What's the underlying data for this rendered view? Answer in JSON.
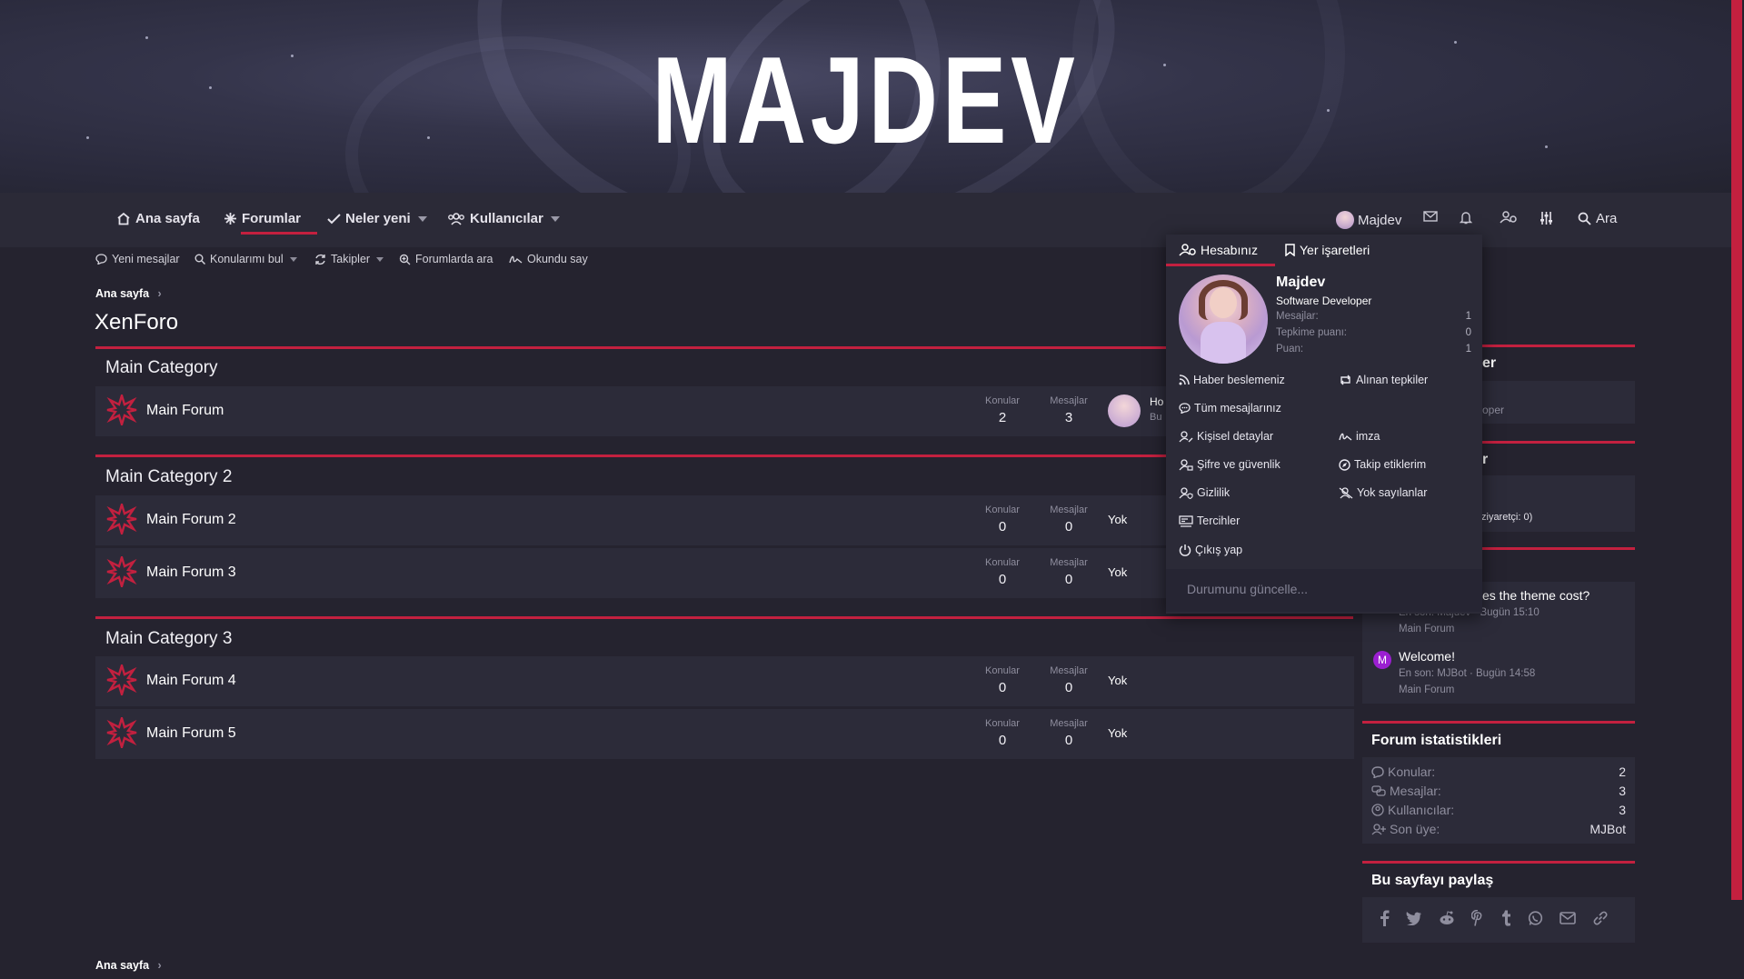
{
  "logo": {
    "text": "MAJDEV"
  },
  "nav": {
    "items": [
      {
        "label": "Ana sayfa"
      },
      {
        "label": "Forumlar"
      },
      {
        "label": "Neler yeni"
      },
      {
        "label": "Kullanıcılar"
      }
    ],
    "user": {
      "label": "Majdev"
    },
    "search": {
      "label": "Ara"
    }
  },
  "subnav": {
    "items": [
      {
        "label": "Yeni mesajlar"
      },
      {
        "label": "Konularımı bul"
      },
      {
        "label": "Takipler"
      },
      {
        "label": "Forumlarda ara"
      },
      {
        "label": "Okundu say"
      }
    ]
  },
  "breadcrumb": {
    "home": "Ana sayfa"
  },
  "page": {
    "title": "XenForo"
  },
  "stat_labels": {
    "threads": "Konular",
    "messages": "Mesajlar"
  },
  "categories": [
    {
      "title": "Main Category",
      "forums": [
        {
          "name": "Main Forum",
          "threads": "2",
          "messages": "3",
          "last_title": "Ho",
          "last_meta": "Bu"
        }
      ]
    },
    {
      "title": "Main Category 2",
      "forums": [
        {
          "name": "Main Forum 2",
          "threads": "0",
          "messages": "0",
          "last": "Yok"
        },
        {
          "name": "Main Forum 3",
          "threads": "0",
          "messages": "0",
          "last": "Yok"
        }
      ]
    },
    {
      "title": "Main Category 3",
      "forums": [
        {
          "name": "Main Forum 4",
          "threads": "0",
          "messages": "0",
          "last": "Yok"
        },
        {
          "name": "Main Forum 5",
          "threads": "0",
          "messages": "0",
          "last": "Yok"
        }
      ]
    }
  ],
  "dropdown": {
    "tab_account": "Hesabınız",
    "tab_bookmarks": "Yer işaretleri",
    "name": "Majdev",
    "role": "Software Developer",
    "stats": [
      {
        "label": "Mesajlar:",
        "value": "1"
      },
      {
        "label": "Tepkime puanı:",
        "value": "0"
      },
      {
        "label": "Puan:",
        "value": "1"
      }
    ],
    "links": {
      "feed": "Haber beslemeniz",
      "reactions": "Alınan tepkiler",
      "all_posts": "Tüm mesajlarınız",
      "details": "Kişisel detaylar",
      "signature": "imza",
      "security": "Şifre ve güvenlik",
      "following": "Takip etiklerim",
      "privacy": "Gizlilik",
      "ignored": "Yok sayılanlar",
      "preferences": "Tercihler",
      "logout": "Çıkış yap"
    },
    "status_placeholder": "Durumunu güncelle..."
  },
  "sidebar": {
    "peek_1": "er",
    "peek_2": "oper",
    "peek_3": "r",
    "peek_4": "ziyaretçi: 0)",
    "latest": [
      {
        "title": "es the theme cost?",
        "meta": "En son: Majdev · Bugün 15:10",
        "forum": "Main Forum"
      },
      {
        "title": "Welcome!",
        "meta": "En son: MJBot · Bugün 14:58",
        "forum": "Main Forum",
        "avatar_letter": "M"
      }
    ],
    "stats_title": "Forum istatistikleri",
    "stats": [
      {
        "label": "Konular:",
        "value": "2"
      },
      {
        "label": "Mesajlar:",
        "value": "3"
      },
      {
        "label": "Kullanıcılar:",
        "value": "3"
      },
      {
        "label": "Son üye:",
        "value": "MJBot"
      }
    ],
    "share_title": "Bu sayfayı paylaş"
  },
  "footer": {
    "breadcrumb": "Ana sayfa"
  },
  "colors": {
    "accent": "#c3203f",
    "background": "#25232f",
    "panel": "#2c2b39"
  }
}
